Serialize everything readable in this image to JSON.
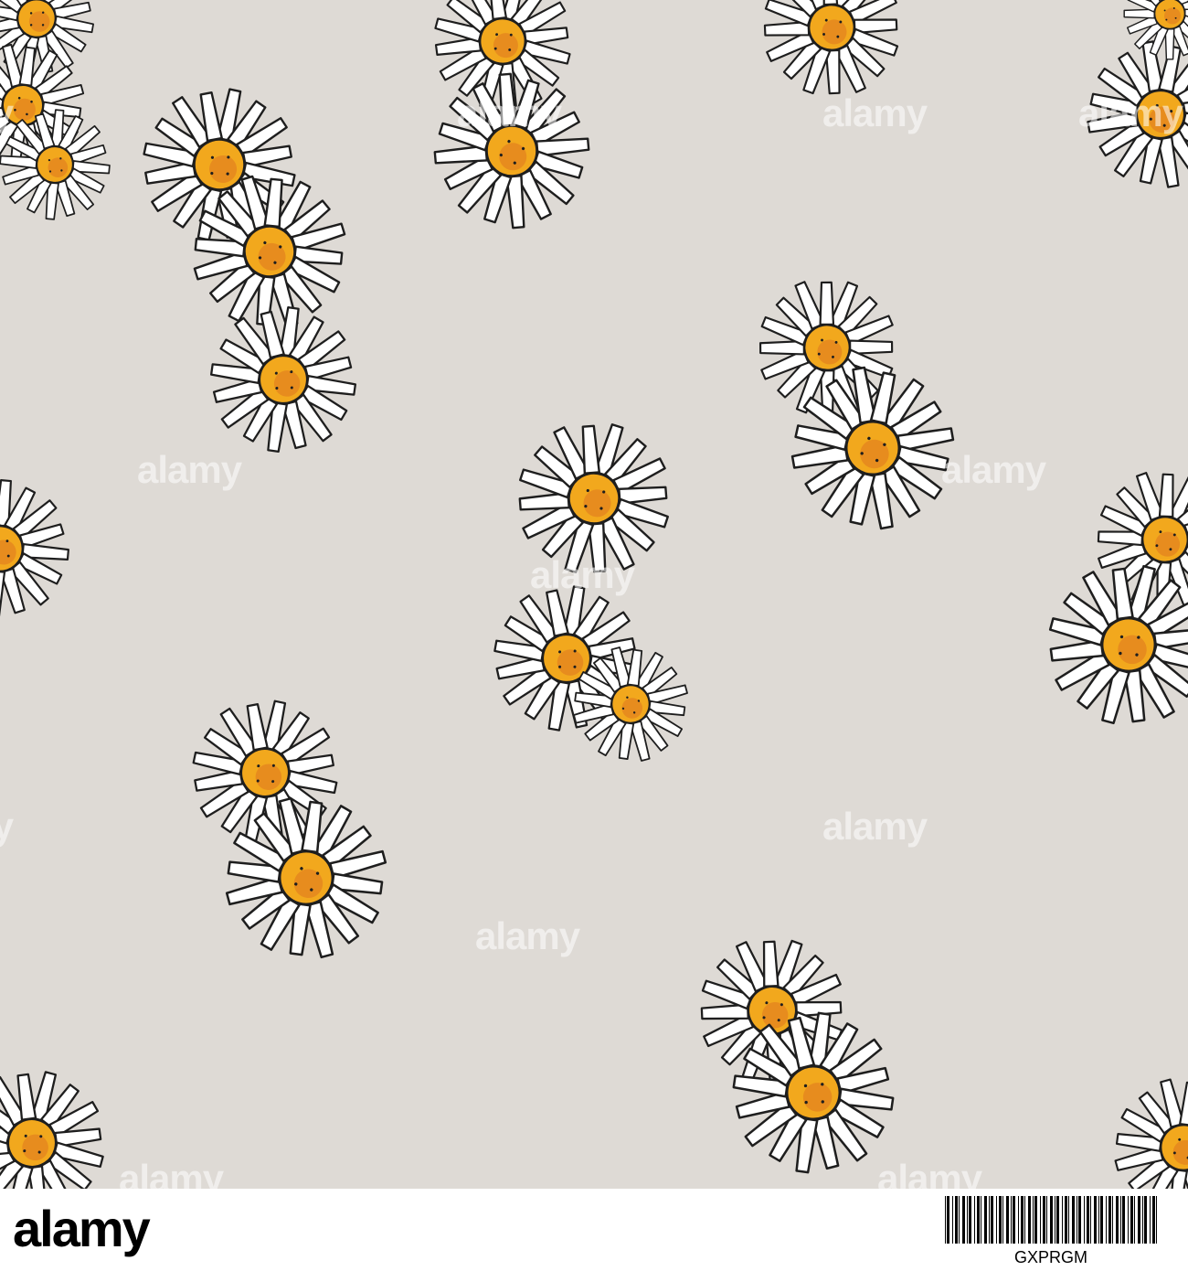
{
  "image": {
    "subject": "daisy-pattern",
    "colors": {
      "paper": "#dedad5",
      "petal": "#ffffff",
      "outline": "#1e1e1e",
      "center": "#f2a81d",
      "center_shade": "#e07a20"
    }
  },
  "watermark": {
    "text": "alamy"
  },
  "footer": {
    "logo": "alamy",
    "stock_id": "GXPRGM",
    "colors": {
      "background": "#ffffff",
      "text": "#000000"
    }
  }
}
